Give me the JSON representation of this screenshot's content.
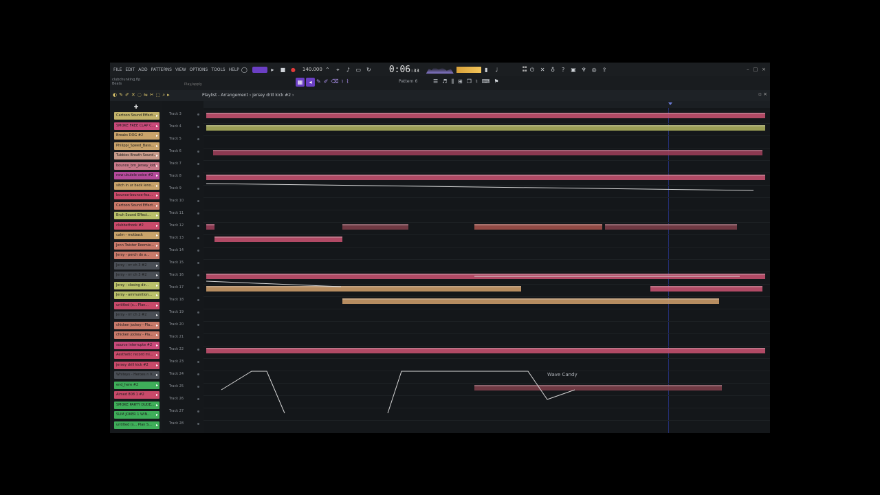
{
  "menu": [
    "FILE",
    "EDIT",
    "ADD",
    "PATTERNS",
    "VIEW",
    "OPTIONS",
    "TOOLS",
    "HELP"
  ],
  "transport": {
    "tempo": "140.000",
    "clock_main": "0:06",
    "clock_sub": ":33"
  },
  "file_info": {
    "name": "clubchunking.flp",
    "sub": "Beats"
  },
  "toolbar2": {
    "undo_label": "Play/apply",
    "pattern": "Pattern 6"
  },
  "playlist": {
    "title": "Playlist - Arrangement › jersey drill kick #2 ›"
  },
  "wave_candy_label": "Wave Candy",
  "patterns": [
    {
      "name": "Cartoon Sound Effect...",
      "color": "#c2b26a"
    },
    {
      "name": "SMOKE FREE CLAP C...",
      "color": "#c94a7a"
    },
    {
      "name": "Breaks DOG #2",
      "color": "#c9a36a"
    },
    {
      "name": "Philippi_Speed_Bass...",
      "color": "#c9a36a"
    },
    {
      "name": "Tubbies Breath Sound...",
      "color": "#c79a8a"
    },
    {
      "name": "bounce_bm_jersey_kid...",
      "color": "#c97a8a"
    },
    {
      "name": "new ukulele voice #2",
      "color": "#b44a9a"
    },
    {
      "name": "sitch in ur back leno...",
      "color": "#c9a36a"
    },
    {
      "name": "bounce-bounce-fea...",
      "color": "#c94a6a"
    },
    {
      "name": "Cartoon Sound Effect...",
      "color": "#c97a6a"
    },
    {
      "name": "Bruh Sound Effect...",
      "color": "#b9c06a"
    },
    {
      "name": "clubbethook #2",
      "color": "#c94a6a"
    },
    {
      "name": "calm - motback",
      "color": "#c9a36a"
    },
    {
      "name": "Jenn Twister Roomie...",
      "color": "#c97a6a"
    },
    {
      "name": "Jersy - perch do a...",
      "color": "#c97a6a"
    },
    {
      "name": "Jersy - rrr ch 3 #2",
      "color": "#4a4f56"
    },
    {
      "name": "Jersy - rrr ch 3 #2",
      "color": "#4a4f56"
    },
    {
      "name": "Jersy - closing dir...",
      "color": "#b9c06a"
    },
    {
      "name": "Jersy - ammunition...",
      "color": "#b9c06a"
    },
    {
      "name": "untitled (s... Plan...",
      "color": "#c94a6a"
    },
    {
      "name": "Jersy - rrr ch 2 #2",
      "color": "#4a4f56"
    },
    {
      "name": "chicken jockey - Pla...",
      "color": "#c97a6a"
    },
    {
      "name": "chicken jockey - Pla...",
      "color": "#c97a6a"
    },
    {
      "name": "source interrupte #2",
      "color": "#c94a7a"
    },
    {
      "name": "Aesthetic record mi...",
      "color": "#c94a6a"
    },
    {
      "name": "jersey drill kick #2",
      "color": "#c94a6a"
    },
    {
      "name": "Whiteys - Heroes n V...",
      "color": "#4a4f56"
    },
    {
      "name": "end_here #2",
      "color": "#3fae5a"
    },
    {
      "name": "Aimed 808 1 #2",
      "color": "#c94a6a"
    },
    {
      "name": "SMOKE PARTY DUDE...",
      "color": "#3fae5a"
    },
    {
      "name": "SLIM JOKER 1 WIN...",
      "color": "#3fae5a"
    },
    {
      "name": "untitled (s... Plan S...",
      "color": "#3fae5a"
    }
  ],
  "tracks": [
    "Track 3",
    "Track 4",
    "Track 5",
    "Track 6",
    "Track 7",
    "Track 8",
    "Track 9",
    "Track 10",
    "Track 11",
    "Track 12",
    "Track 13",
    "Track 14",
    "Track 15",
    "Track 16",
    "Track 17",
    "Track 18",
    "Track 19",
    "Track 20",
    "Track 21",
    "Track 22",
    "Track 23",
    "Track 24",
    "Track 25",
    "Track 26",
    "Track 27",
    "Track 28"
  ],
  "colors": {
    "accent": "#6b3fc4",
    "pink_clip": "#c2506e",
    "olive_clip": "#a9ad5c",
    "tan_clip": "#c99a68",
    "playhead": "#6b7bd6"
  }
}
